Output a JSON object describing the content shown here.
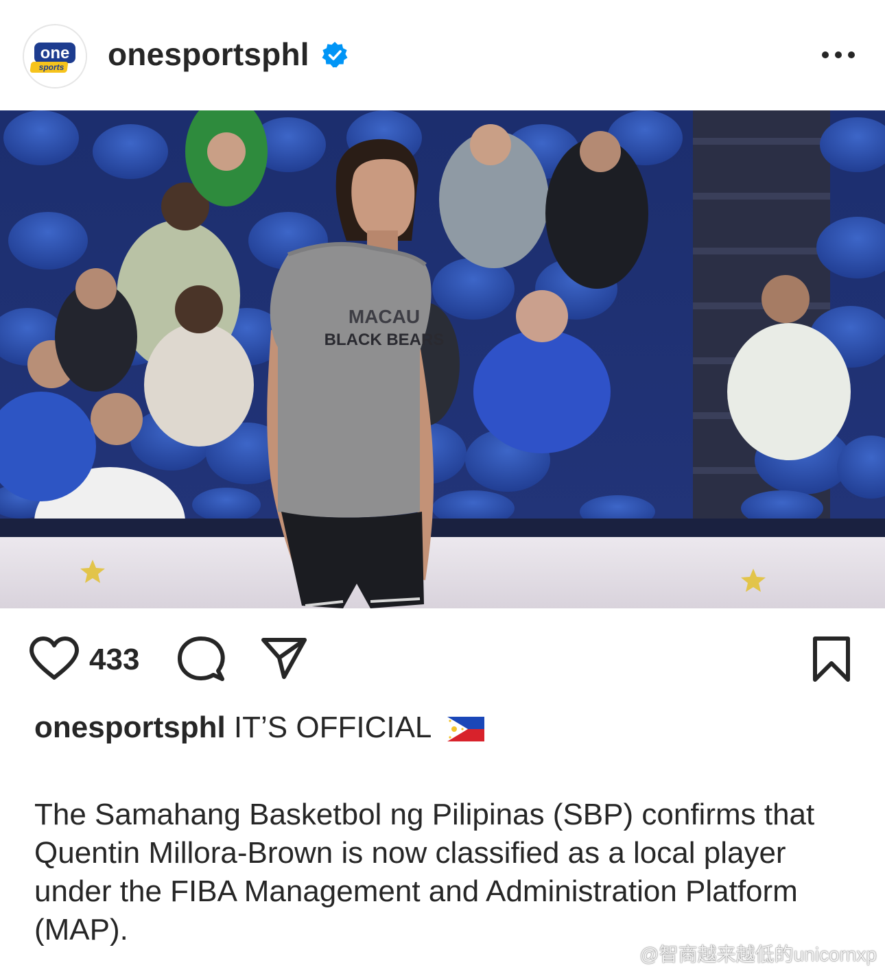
{
  "header": {
    "avatar": {
      "logo_text_top": "one",
      "logo_text_bottom": "sports"
    },
    "username": "onesportsphl",
    "verified_icon": "verified-badge-icon",
    "more_icon": "more-horizontal-icon"
  },
  "post": {
    "image_alt": "Basketball player in gray Macau Black Bears t-shirt standing on court with spectators behind",
    "shirt_text_1": "MACAU",
    "shirt_text_2": "BLACK BEARS"
  },
  "actions": {
    "like_icon": "heart-icon",
    "like_count": "433",
    "comment_icon": "comment-icon",
    "share_icon": "share-icon",
    "save_icon": "bookmark-icon"
  },
  "caption": {
    "username": "onesportsphl",
    "headline": "IT’S OFFICIAL",
    "flag_icon": "philippines-flag-icon",
    "body": "The Samahang Basketbol ng Pilipinas (SBP) confirms that Quentin Millora-Brown is now classified as a local player under the FIBA Management and Administration Platform (MAP)."
  },
  "watermark": {
    "text": "@智商越来越低的unicornxp"
  },
  "colors": {
    "verified_blue": "#0095f6",
    "text": "#262626",
    "logo_blue": "#1d3c8f",
    "logo_yellow": "#f6c31c"
  }
}
